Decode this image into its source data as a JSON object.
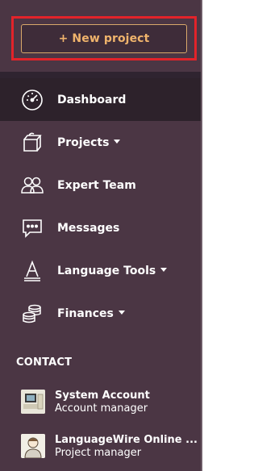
{
  "actions": {
    "new_project_label": "+ New project"
  },
  "nav": {
    "items": [
      {
        "label": "Dashboard",
        "icon": "speedometer-icon",
        "active": true,
        "dropdown": false
      },
      {
        "label": "Projects",
        "icon": "projects-box-icon",
        "active": false,
        "dropdown": true
      },
      {
        "label": "Expert Team",
        "icon": "team-icon",
        "active": false,
        "dropdown": false
      },
      {
        "label": "Messages",
        "icon": "message-bubble-icon",
        "active": false,
        "dropdown": false
      },
      {
        "label": "Language Tools",
        "icon": "language-tools-icon",
        "active": false,
        "dropdown": true
      },
      {
        "label": "Finances",
        "icon": "coins-icon",
        "active": false,
        "dropdown": true
      }
    ]
  },
  "contact": {
    "heading": "CONTACT",
    "items": [
      {
        "name": "System Account",
        "role": "Account manager"
      },
      {
        "name": "LanguageWire Online ...",
        "role": "Project manager"
      }
    ]
  },
  "colors": {
    "sidebar_bg": "#4b3644",
    "active_bg": "#2d222b",
    "accent": "#f0b46c",
    "highlight": "#e2232a"
  }
}
